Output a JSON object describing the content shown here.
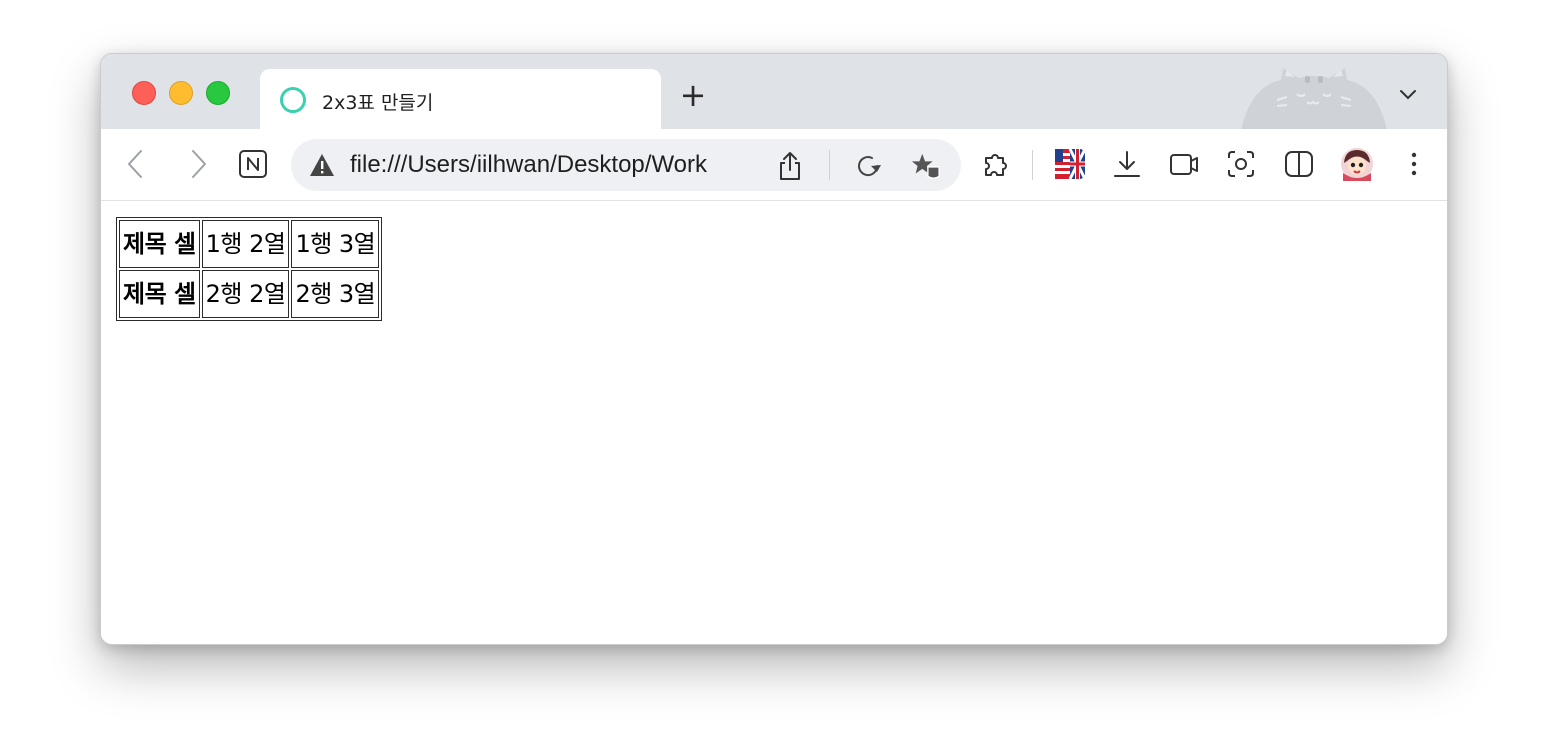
{
  "browser": {
    "tab": {
      "title": "2x3표 만들기"
    },
    "new_tab_label": "+",
    "address_bar": {
      "url": "file:///Users/iilhwan/Desktop/Work"
    },
    "icons": {
      "back": "chevron-left-icon",
      "forward": "chevron-right-icon",
      "notion": "notion-icon",
      "warning": "warning-triangle-icon",
      "share": "share-icon",
      "reload": "reload-icon",
      "bookmark": "bookmark-star-icon",
      "extensions": "puzzle-icon",
      "flag": "flag-extension-icon",
      "download": "download-icon",
      "camera": "video-icon",
      "screenshot": "screenshot-icon",
      "split": "split-view-icon",
      "profile": "profile-avatar",
      "menu": "kebab-menu-icon",
      "tab_dropdown": "chevron-down-icon"
    },
    "colors": {
      "titlebar": "#dfe2e7",
      "tab_favicon": "#3bd1b0",
      "traffic_red": "#fe5f57",
      "traffic_yellow": "#febc2e",
      "traffic_green": "#28c840"
    }
  },
  "page": {
    "table": {
      "rows": [
        {
          "header": "제목 셀",
          "cells": [
            "1행 2열",
            "1행 3열"
          ]
        },
        {
          "header": "제목 셀",
          "cells": [
            "2행 2열",
            "2행 3열"
          ]
        }
      ]
    }
  }
}
